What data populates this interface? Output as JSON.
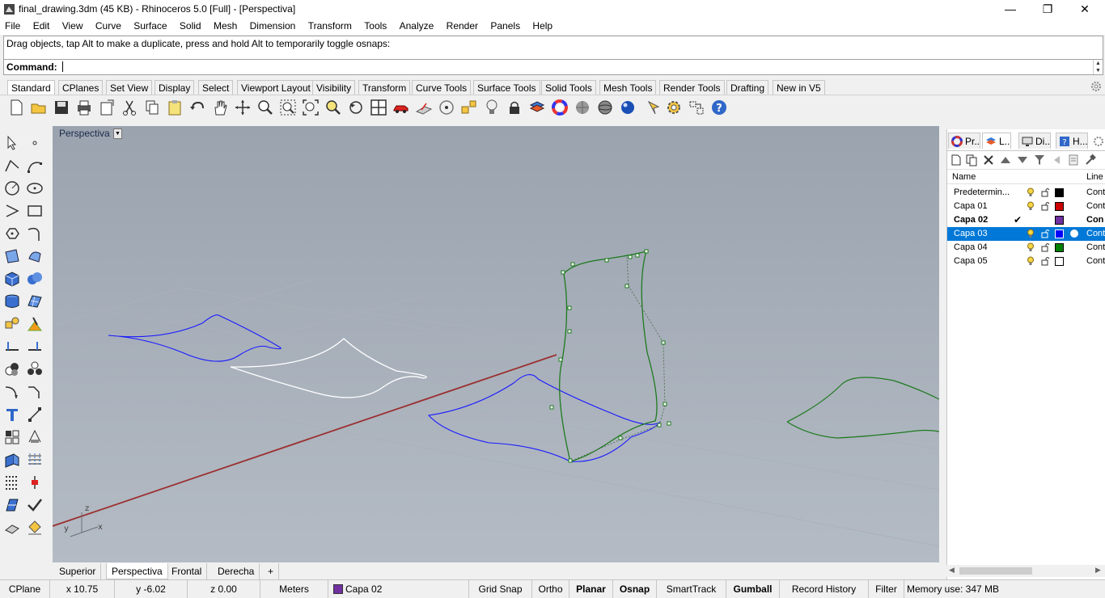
{
  "window": {
    "title": "final_drawing.3dm (45 KB) - Rhinoceros 5.0 [Full] - [Perspectiva]",
    "minimize": "—",
    "restore": "❐",
    "close": "✕"
  },
  "menu": [
    "File",
    "Edit",
    "View",
    "Curve",
    "Surface",
    "Solid",
    "Mesh",
    "Dimension",
    "Transform",
    "Tools",
    "Analyze",
    "Render",
    "Panels",
    "Help"
  ],
  "command": {
    "history": "Drag objects, tap Alt to make a duplicate, press and hold Alt to temporarily toggle osnaps:",
    "label": "Command:",
    "spin_up": "▲",
    "spin_down": "▼"
  },
  "toolbar_tabs": [
    "Standard",
    "CPlanes",
    "Set View",
    "Display",
    "Select",
    "Viewport Layout",
    "Visibility",
    "Transform",
    "Curve Tools",
    "Surface Tools",
    "Solid Tools",
    "Mesh Tools",
    "Render Tools",
    "Drafting",
    "New in V5"
  ],
  "viewport": {
    "title": "Perspectiva",
    "dropdown": "▼",
    "axis_z": "z",
    "axis_y": "y",
    "axis_x": "x"
  },
  "viewport_tabs": [
    "Superior",
    "Perspectiva",
    "Frontal",
    "Derecha"
  ],
  "viewport_tab_add": "+",
  "panel": {
    "tabs": [
      "Pr...",
      "L...",
      "Di...",
      "H..."
    ],
    "header_name": "Name",
    "header_line": "Line",
    "layers": [
      {
        "name": "Predetermin...",
        "color": "#000000",
        "line": "Cont"
      },
      {
        "name": "Capa 01",
        "color": "#cc0000",
        "line": "Cont"
      },
      {
        "name": "Capa 02",
        "color": "#7030a0",
        "line": "Con",
        "current": "✔"
      },
      {
        "name": "Capa 03",
        "color": "#0000ff",
        "line": "Cont"
      },
      {
        "name": "Capa 04",
        "color": "#008000",
        "line": "Cont"
      },
      {
        "name": "Capa 05",
        "color": "#ffffff",
        "line": "Cont"
      }
    ],
    "scroll_left": "◀",
    "scroll_right": "▶"
  },
  "status": {
    "cplane": "CPlane",
    "x": "x 10.75",
    "y": "y -6.02",
    "z": "z 0.00",
    "units": "Meters",
    "layer": "Capa 02",
    "layer_color": "#7030a0",
    "grid_snap": "Grid Snap",
    "ortho": "Ortho",
    "planar": "Planar",
    "osnap": "Osnap",
    "smarttrack": "SmartTrack",
    "gumball": "Gumball",
    "record_history": "Record History",
    "filter": "Filter",
    "memory": "Memory use: 347 MB"
  },
  "colors": {
    "viewport_bg": "#a5adb8",
    "selection": "#0078d7",
    "curve_blue": "#1a1aff",
    "curve_green": "#1e7a1e",
    "x_axis": "#9b3030"
  }
}
